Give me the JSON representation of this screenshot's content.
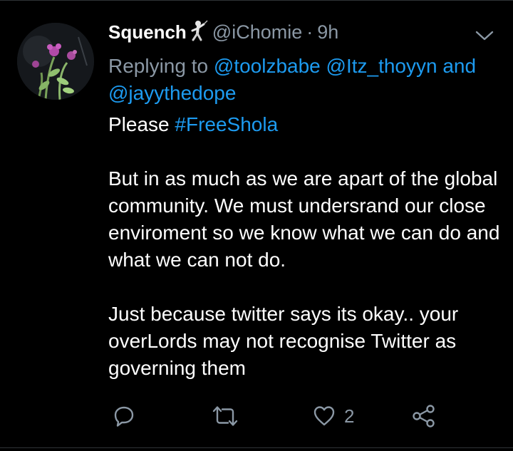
{
  "tweet": {
    "display_name": "Squench",
    "name_emoji_icon": "person-fencing-icon",
    "handle": "@iChomie",
    "separator": "·",
    "time": "9h",
    "replying_prefix": "Replying to",
    "reply_handle_1": "@toolzbabe",
    "reply_handle_2": "@Itz_thoyyn",
    "reply_and": "and",
    "reply_handle_3": "@jayythedope",
    "line1_prefix": "Please",
    "hashtag": "#FreeShola",
    "paragraph_2": "But in as much as we are apart of the global community. We must undersrand our close enviroment so we know what we can do and what we can not do.",
    "paragraph_3": "Just because twitter says its okay.. your overLords may not recognise Twitter as governing them"
  },
  "actions": {
    "reply_icon": "reply-icon",
    "retweet_icon": "retweet-icon",
    "like_icon": "heart-icon",
    "like_count": "2",
    "share_icon": "share-icon"
  },
  "colors": {
    "background": "#000000",
    "text": "#ffffff",
    "secondary": "#8b98a5",
    "link": "#1d9bf0",
    "divider": "#2f3336"
  }
}
